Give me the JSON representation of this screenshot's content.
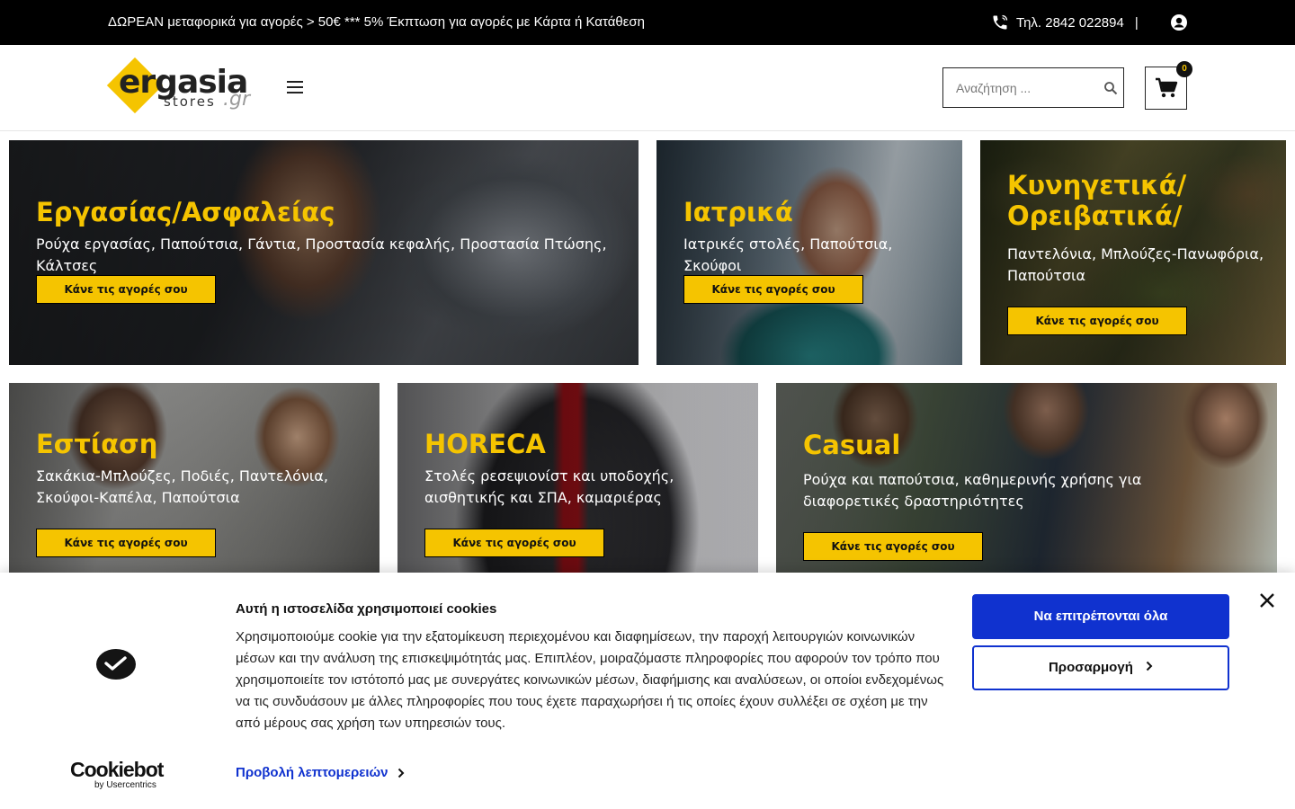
{
  "topbar": {
    "promo": "ΔΩΡΕΑΝ μεταφορικά για αγορές > 50€  ***  5% Έκπτωση για αγορές με Κάρτα ή Κατάθεση",
    "phone": "Τηλ.  2842 022894",
    "separator": "|",
    "icons": {
      "phone": "phone-icon",
      "account": "user-circle-icon"
    }
  },
  "header": {
    "logo": {
      "main": "ergasia",
      "sub": "stores",
      "tld": ".gr"
    },
    "menu_icon": "hamburger-icon",
    "search": {
      "placeholder": "Αναζήτηση ..."
    },
    "cart": {
      "count": "0"
    },
    "colors": {
      "brand_yellow": "#f5c400",
      "topbar_bg": "#000000"
    }
  },
  "categories": [
    {
      "title": "Εργασίας/Ασφαλείας",
      "text": "Ρούχα εργασίας, Παπούτσια, Γάντια, Προστασία κεφαλής, Προστασία Πτώσης, Κάλτσες",
      "cta": "Κάνε τις αγορές σου"
    },
    {
      "title": "Ιατρικά",
      "text": "Ιατρικές στολές, Παπούτσια, Σκούφοι",
      "cta": "Κάνε τις αγορές σου"
    },
    {
      "title_line1": "Κυνηγετικά/",
      "title_line2": "Ορειβατικά/",
      "text": "Παντελόνια, Μπλούζες-Πανωφόρια, Παπούτσια",
      "cta": "Κάνε τις αγορές σου"
    },
    {
      "title": "Εστίαση",
      "text": "Σακάκια-Μπλούζες, Ποδιές, Παντελόνια, Σκούφοι-Καπέλα, Παπούτσια",
      "cta": "Κάνε τις αγορές σου"
    },
    {
      "title": "HORECA",
      "text": "Στολές ρεσεψιονίστ και υποδοχής, αισθητικής και ΣΠΑ, καμαριέρας",
      "cta": "Κάνε τις αγορές σου"
    },
    {
      "title": "Casual",
      "text": "Ρούχα και παπούτσια, καθημερινής χρήσης για διαφορετικές δραστηριότητες",
      "cta": "Κάνε τις αγορές σου"
    }
  ],
  "cookie_banner": {
    "title": "Αυτή η ιστοσελίδα χρησιμοποιεί cookies",
    "description": "Χρησιμοποιούμε cookie για την εξατομίκευση περιεχομένου και διαφημίσεων, την παροχή λειτουργιών κοινωνικών μέσων και την ανάλυση της επισκεψιμότητάς μας. Επιπλέον, μοιραζόμαστε πληροφορίες που αφορούν τον τρόπο που χρησιμοποιείτε τον ιστότοπό μας με συνεργάτες κοινωνικών μέσων, διαφήμισης και αναλύσεων, οι οποίοι ενδεχομένως να τις συνδυάσουν με άλλες πληροφορίες που τους έχετε παραχωρήσει ή τις οποίες έχουν συλλέξει σε σχέση με την από μέρους σας χρήση των υπηρεσιών τους.",
    "details_link": "Προβολή λεπτομερειών",
    "allow_all": "Να επιτρέπονται όλα",
    "customize": "Προσαρμογή",
    "brand": "Cookiebot",
    "brand_sub": "by Usercentrics",
    "colors": {
      "accent": "#1032cf"
    }
  }
}
